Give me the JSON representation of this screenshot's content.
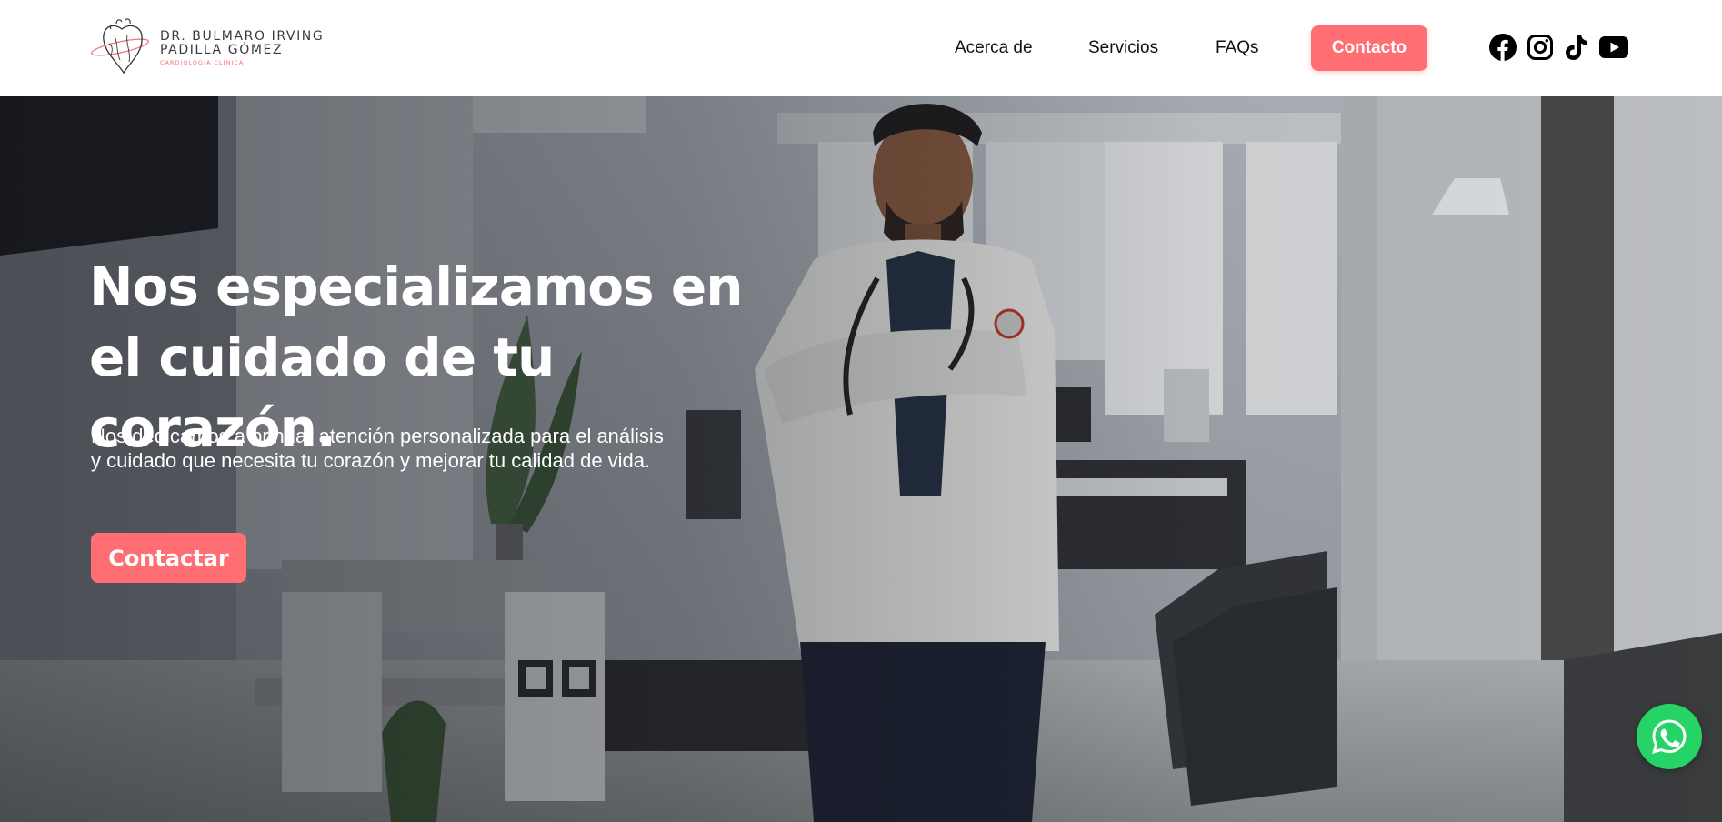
{
  "header": {
    "brand": {
      "line1": "DR. BULMARO IRVING",
      "line2": "PADILLA GÓMEZ",
      "subtitle": "CARDIOLOGÍA CLÍNICA"
    },
    "nav": [
      {
        "label": "Acerca de"
      },
      {
        "label": "Servicios"
      },
      {
        "label": "FAQs"
      }
    ],
    "contact_label": "Contacto",
    "social": [
      "facebook-icon",
      "instagram-icon",
      "tiktok-icon",
      "youtube-icon"
    ]
  },
  "hero": {
    "title": "Nos especializamos en el cuidado de tu corazón.",
    "text": "Nos dedicamos a brindar atención personalizada para el análisis y cuidado que necesita tu corazón y mejorar tu calidad de vida.",
    "cta_label": "Contactar"
  },
  "floating": {
    "whatsapp_icon": "whatsapp-icon"
  },
  "colors": {
    "accent": "#ff6e73",
    "whatsapp": "#25d366",
    "text_dark": "#111111",
    "text_light": "#ffffff"
  }
}
